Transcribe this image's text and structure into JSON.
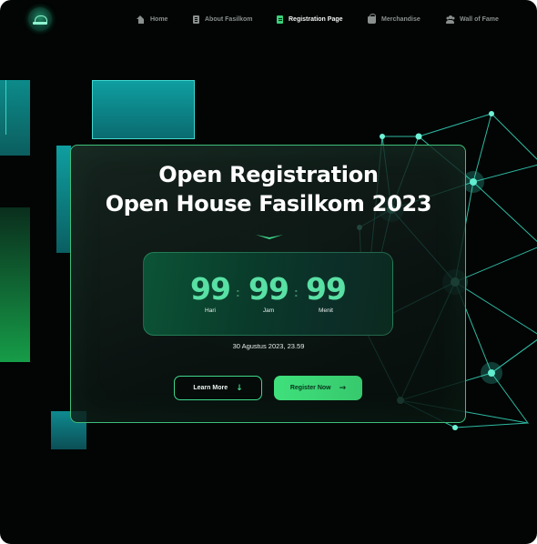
{
  "nav": {
    "items": [
      {
        "label": "Home",
        "icon": "home-icon",
        "active": false
      },
      {
        "label": "About Fasilkom",
        "icon": "building-icon",
        "active": false
      },
      {
        "label": "Registration Page",
        "icon": "document-icon",
        "active": true
      },
      {
        "label": "Merchandise",
        "icon": "shopping-bag-icon",
        "active": false
      },
      {
        "label": "Wall of Fame",
        "icon": "people-icon",
        "active": false
      }
    ]
  },
  "hero": {
    "title_line1": "Open Registration",
    "title_line2": "Open House Fasilkom 2023"
  },
  "countdown": {
    "days": {
      "value": "99",
      "label": "Hari"
    },
    "hours": {
      "value": "99",
      "label": "Jam"
    },
    "minutes": {
      "value": "99",
      "label": "Menit"
    },
    "separator": ":",
    "deadline": "30 Agustus 2023, 23.59"
  },
  "actions": {
    "learn_more": "Learn More",
    "register_now": "Register Now"
  },
  "colors": {
    "background": "#020504",
    "accent_green": "#3fe07c",
    "countdown_digits": "#59e0a4",
    "teal_decor": "#0f9ea0",
    "network_lines": "#3de0c4"
  }
}
